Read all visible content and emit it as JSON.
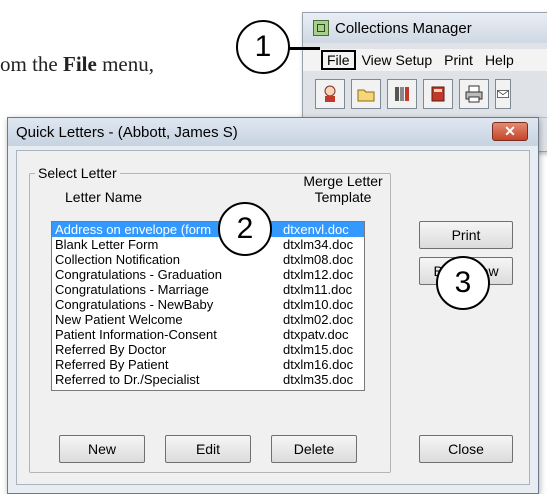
{
  "doc_fragment": {
    "prefix": "om the ",
    "bold": "File",
    "suffix": " menu,"
  },
  "collections_window": {
    "title": "Collections Manager",
    "menus": [
      "File",
      "View Setup",
      "Print",
      "Help"
    ],
    "toolbar_icons": [
      "patient-icon",
      "folder-icon",
      "ledger-icon",
      "book-icon",
      "printer-icon",
      "envelope-icon"
    ]
  },
  "callouts": [
    "1",
    "2",
    "3"
  ],
  "dialog": {
    "title": "Quick Letters - (Abbott, James S)",
    "close_glyph": "✕",
    "group_label": "Select Letter",
    "col_name": "Letter Name",
    "col_template": "Merge Letter Template",
    "letters": [
      {
        "name": "Address on envelope (form",
        "template": "dtxenvl.doc",
        "selected": true
      },
      {
        "name": "Blank Letter Form",
        "template": "dtxlm34.doc"
      },
      {
        "name": "Collection Notification",
        "template": "dtxlm08.doc"
      },
      {
        "name": "Congratulations - Graduation",
        "template": "dtxlm12.doc"
      },
      {
        "name": "Congratulations - Marriage",
        "template": "dtxlm11.doc"
      },
      {
        "name": "Congratulations - NewBaby",
        "template": "dtxlm10.doc"
      },
      {
        "name": "New Patient Welcome",
        "template": "dtxlm02.doc"
      },
      {
        "name": "Patient Information-Consent",
        "template": "dtxpatv.doc"
      },
      {
        "name": "Referred By Doctor",
        "template": "dtxlm15.doc"
      },
      {
        "name": "Referred By Patient",
        "template": "dtxlm16.doc"
      },
      {
        "name": "Referred to Dr./Specialist",
        "template": "dtxlm35.doc"
      }
    ],
    "buttons": {
      "print": "Print",
      "build": "Build/View",
      "new": "New",
      "edit": "Edit",
      "delete": "Delete",
      "close": "Close"
    }
  },
  "colors": {
    "selection": "#3399ff",
    "close_button": "#c4462a"
  }
}
